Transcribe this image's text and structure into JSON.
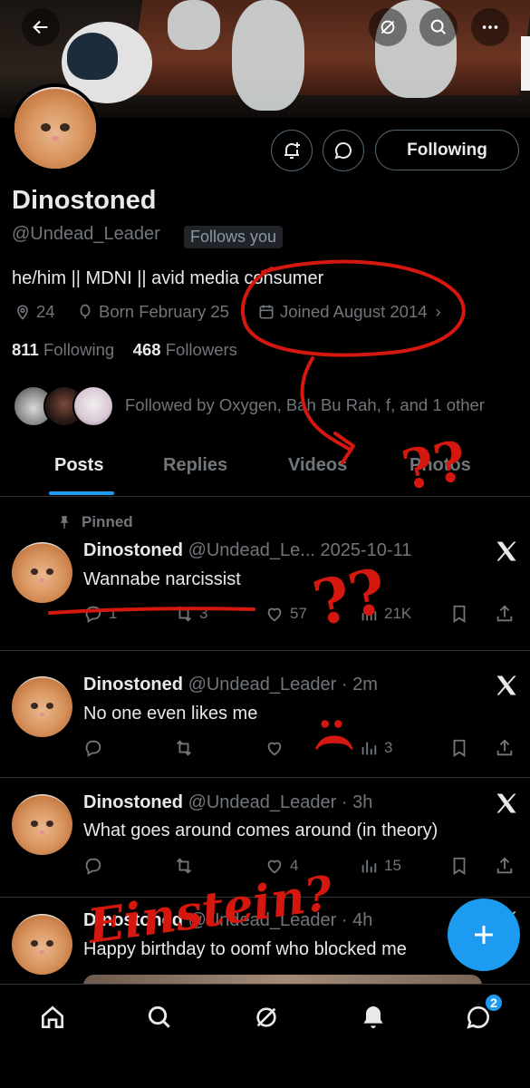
{
  "header": {
    "back_icon": "back-arrow-icon",
    "actions": [
      "grok-icon",
      "search-icon",
      "more-icon"
    ]
  },
  "profile": {
    "name": "Dinostoned",
    "handle": "@Undead_Leader",
    "follows_you": "Follows you",
    "bio": "he/him || MDNI || avid media consumer",
    "location": "24",
    "birthday": "Born February 25",
    "joined": "Joined August 2014",
    "following_count": "811",
    "following_label": "Following",
    "followers_count": "468",
    "followers_label": "Followers",
    "followed_by": "Followed by Oxygen, Bah Bu Rah, f, and 1 other",
    "follow_button": "Following"
  },
  "tabs": [
    {
      "label": "Posts",
      "active": true
    },
    {
      "label": "Replies",
      "active": false
    },
    {
      "label": "Videos",
      "active": false
    },
    {
      "label": "Photos",
      "active": false
    }
  ],
  "pinned_label": "Pinned",
  "posts": [
    {
      "name": "Dinostoned",
      "handle": "@Undead_Le...",
      "time": "2025-10-11",
      "text": "Wannabe narcissist",
      "replies": "1",
      "reposts": "3",
      "likes": "57",
      "views": "21K"
    },
    {
      "name": "Dinostoned",
      "handle": "@Undead_Leader",
      "time": "2m",
      "text": "No one even likes me",
      "replies": "",
      "reposts": "",
      "likes": "",
      "views": "3"
    },
    {
      "name": "Dinostoned",
      "handle": "@Undead_Leader",
      "time": "3h",
      "text": "What goes around comes around (in theory)",
      "replies": "",
      "reposts": "",
      "likes": "4",
      "views": "15"
    },
    {
      "name": "Dinostoned",
      "handle": "@Undead_Leader",
      "time": "4h",
      "text": "Happy birthday to oomf who blocked me"
    }
  ],
  "annotations": {
    "question_marks": "??",
    "question_marks_2": "??",
    "sad_face": ":(",
    "einstein": "Einstein?"
  },
  "nav": {
    "items": [
      "home-icon",
      "search-icon",
      "grok-icon",
      "notifications-icon",
      "messages-icon"
    ],
    "messages_badge": "2"
  },
  "colors": {
    "accent": "#1d9bf0",
    "background": "#000000",
    "secondary_text": "#71767b",
    "scribble": "#d4180f"
  }
}
